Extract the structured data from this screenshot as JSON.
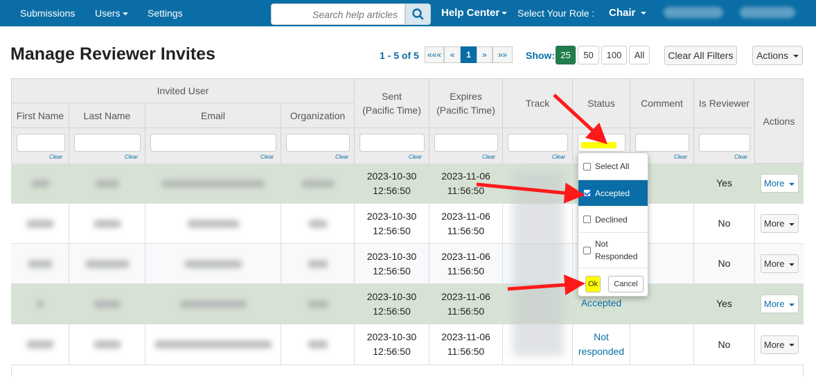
{
  "nav": {
    "submissions": "Submissions",
    "users": "Users",
    "settings": "Settings",
    "search_placeholder": "Search help articles",
    "help_center": "Help Center",
    "role_label": "Select Your Role :",
    "role_value": "Chair"
  },
  "page": {
    "title": "Manage Reviewer Invites",
    "range_text": "1 - 5 of",
    "range_total": "5",
    "pager": {
      "first": "«««",
      "prev": "«",
      "current": "1",
      "next": "»",
      "last": "»»"
    },
    "show_label": "Show:",
    "show_options": [
      "25",
      "50",
      "100",
      "All"
    ],
    "clear_filters": "Clear All Filters",
    "actions": "Actions"
  },
  "table": {
    "group_header": "Invited User",
    "columns": {
      "first_name": "First Name",
      "last_name": "Last Name",
      "email": "Email",
      "organization": "Organization",
      "sent_1": "Sent",
      "sent_2": "(Pacific Time)",
      "expires_1": "Expires",
      "expires_2": "(Pacific Time)",
      "track": "Track",
      "status": "Status",
      "comment": "Comment",
      "is_reviewer": "Is Reviewer",
      "actions": "Actions"
    },
    "clear_label": "Clear",
    "more_label": "More",
    "rows": [
      {
        "sent_date": "2023-10-30",
        "sent_time": "12:56:50",
        "exp_date": "2023-11-06",
        "exp_time": "11:56:50",
        "status": "",
        "is_reviewer": "Yes"
      },
      {
        "sent_date": "2023-10-30",
        "sent_time": "12:56:50",
        "exp_date": "2023-11-06",
        "exp_time": "11:56:50",
        "status": "",
        "is_reviewer": "No"
      },
      {
        "sent_date": "2023-10-30",
        "sent_time": "12:56:50",
        "exp_date": "2023-11-06",
        "exp_time": "11:56:50",
        "status": "",
        "is_reviewer": "No"
      },
      {
        "sent_date": "2023-10-30",
        "sent_time": "12:56:50",
        "exp_date": "2023-11-06",
        "exp_time": "11:56:50",
        "status": "Accepted",
        "is_reviewer": "Yes"
      },
      {
        "sent_date": "2023-10-30",
        "sent_time": "12:56:50",
        "exp_date": "2023-11-06",
        "exp_time": "11:56:50",
        "status_1": "Not",
        "status_2": "responded",
        "is_reviewer": "No"
      }
    ]
  },
  "status_filter": {
    "select_all": "Select All",
    "accepted": "Accepted",
    "declined": "Declined",
    "not_responded_1": "Not",
    "not_responded_2": "Responded",
    "ok": "Ok",
    "cancel": "Cancel"
  },
  "colors": {
    "nav_bg": "#0a6da5",
    "highlight_row": "#d6e2d4",
    "accent_green": "#227d4a",
    "annotation_red": "#ff1a1a",
    "annotation_yellow": "#ffff00"
  }
}
